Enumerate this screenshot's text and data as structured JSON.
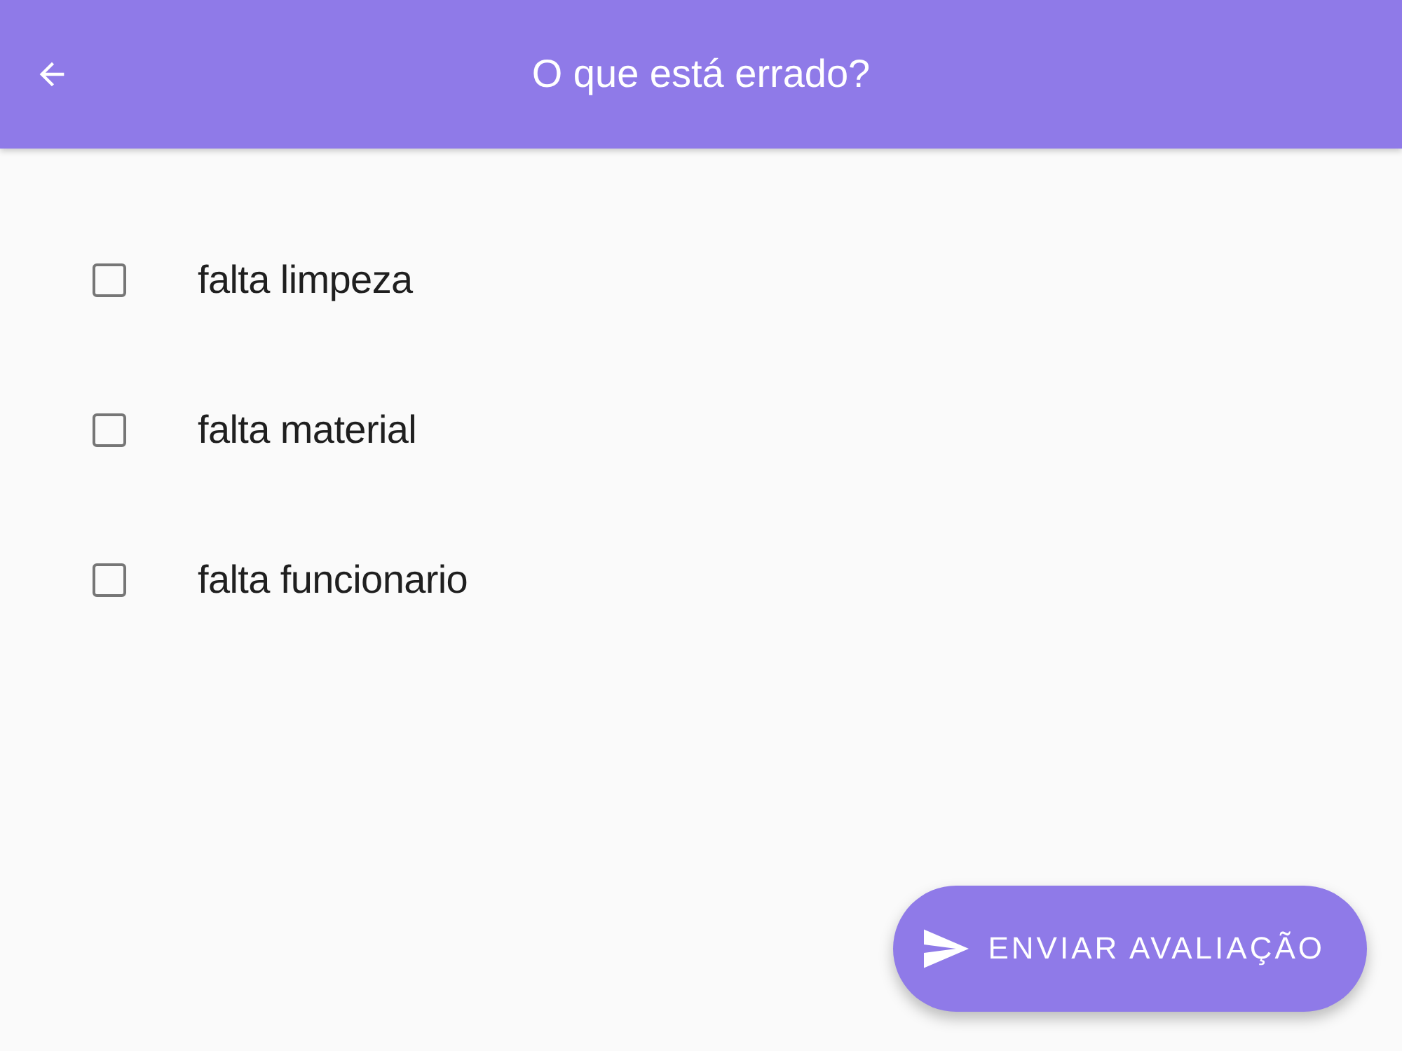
{
  "app_bar": {
    "title": "O que está errado?"
  },
  "options": [
    {
      "label": "falta limpeza",
      "checked": false
    },
    {
      "label": "falta material",
      "checked": false
    },
    {
      "label": "falta funcionario",
      "checked": false
    }
  ],
  "submit_button": {
    "label": "ENVIAR AVALIAÇÃO"
  }
}
